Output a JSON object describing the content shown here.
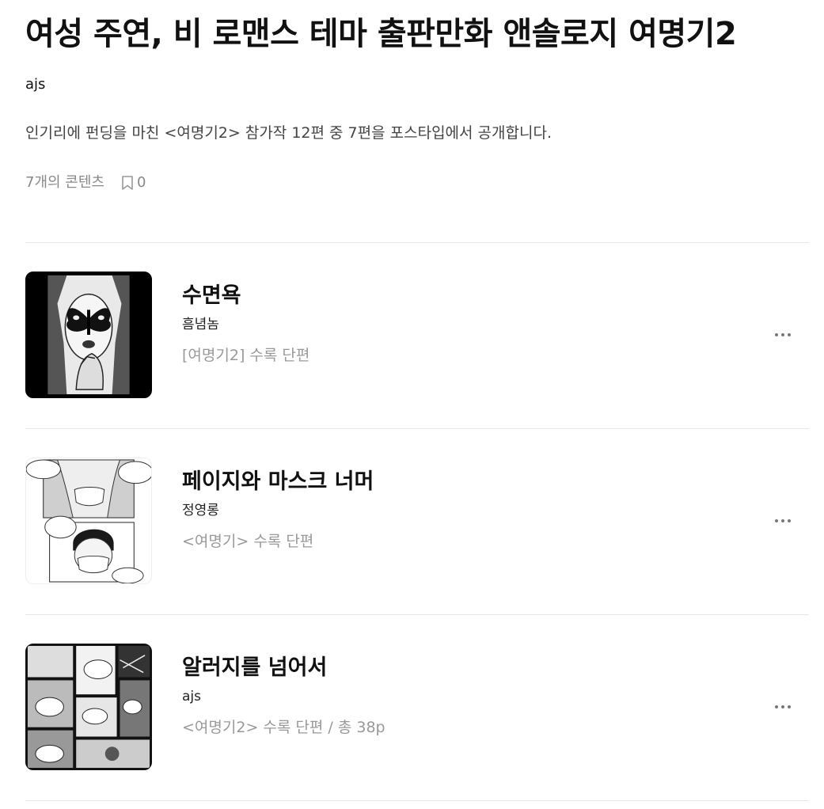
{
  "header": {
    "title": "여성 주연, 비 로맨스 테마 출판만화 앤솔로지 여명기2",
    "author": "ajs",
    "description": "인기리에 펀딩을 마친 <여명기2> 참가작 12편 중 7편을 포스타입에서 공개합니다.",
    "content_count": "7개의 콘텐츠",
    "bookmark_count": "0"
  },
  "items": [
    {
      "title": "수면욕",
      "author": "흠념놈",
      "desc": "[여명기2] 수록 단편",
      "thumb_icon": "butterfly-face-thumbnail"
    },
    {
      "title": "페이지와 마스크 너머",
      "author": "정영롱",
      "desc": "<여명기> 수록 단편",
      "thumb_icon": "masked-faces-comic-thumbnail"
    },
    {
      "title": "알러지를 넘어서",
      "author": "ajs",
      "desc": "<여명기2> 수록 단편 / 총 38p",
      "thumb_icon": "comic-panels-thumbnail"
    }
  ]
}
